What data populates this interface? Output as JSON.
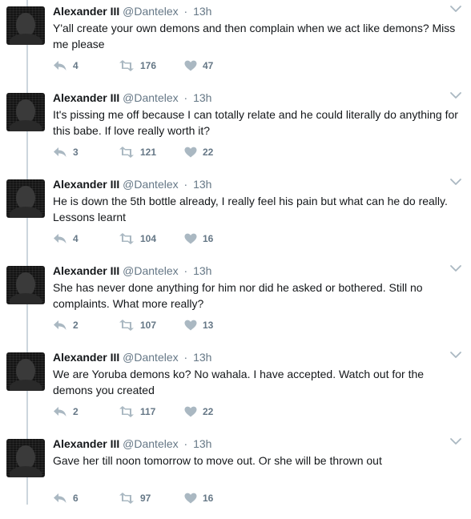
{
  "colors": {
    "text": "#14171a",
    "muted": "#657786",
    "icon": "#aab8c2",
    "line": "#ccd6dd"
  },
  "icons": {
    "reply": "reply-icon",
    "retweet": "retweet-icon",
    "like": "heart-icon",
    "menu": "chevron-down-icon"
  },
  "tweets": [
    {
      "name": "Alexander III",
      "handle": "@Dantelex",
      "separator": "·",
      "time": "13h",
      "text": "Y'all create your own demons and then complain when we act like demons? Miss me please",
      "replies": "4",
      "retweets": "176",
      "likes": "47"
    },
    {
      "name": "Alexander III",
      "handle": "@Dantelex",
      "separator": "·",
      "time": "13h",
      "text": "It's pissing me off because I can totally relate and he could literally do anything for this babe. If love really worth it?",
      "replies": "3",
      "retweets": "121",
      "likes": "22"
    },
    {
      "name": "Alexander III",
      "handle": "@Dantelex",
      "separator": "·",
      "time": "13h",
      "text": "He is down the 5th bottle already, I really feel his pain but what can he do really. Lessons learnt",
      "replies": "4",
      "retweets": "104",
      "likes": "16"
    },
    {
      "name": "Alexander III",
      "handle": "@Dantelex",
      "separator": "·",
      "time": "13h",
      "text": "She has never done anything for him nor did he asked or bothered. Still no complaints. What more really?",
      "replies": "2",
      "retweets": "107",
      "likes": "13"
    },
    {
      "name": "Alexander III",
      "handle": "@Dantelex",
      "separator": "·",
      "time": "13h",
      "text": "We are Yoruba demons ko? No wahala. I have accepted. Watch out for the demons you created",
      "replies": "2",
      "retweets": "117",
      "likes": "22"
    },
    {
      "name": "Alexander III",
      "handle": "@Dantelex",
      "separator": "·",
      "time": "13h",
      "text": "Gave her till noon tomorrow to move out. Or she will be thrown out",
      "replies": "6",
      "retweets": "97",
      "likes": "16"
    }
  ]
}
